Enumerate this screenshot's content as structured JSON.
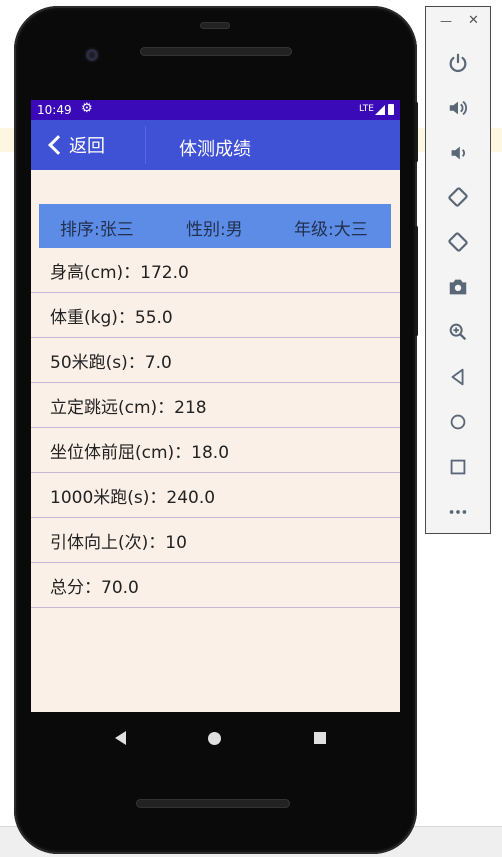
{
  "statusbar": {
    "time": "10:49",
    "network": "LTE"
  },
  "appbar": {
    "back_label": "返回",
    "title": "体测成绩"
  },
  "info": {
    "rank": "排序:张三",
    "gender": "性别:男",
    "grade": "年级:大三"
  },
  "rows": [
    "身高(cm)：172.0",
    "体重(kg)：55.0",
    "50米跑(s)：7.0",
    "立定跳远(cm)：218",
    "坐位体前屈(cm)：18.0",
    "1000米跑(s)：240.0",
    "引体向上(次)：10",
    "总分：70.0"
  ],
  "colors": {
    "statusbar": "#3a0ab8",
    "appbar": "#3f51d4",
    "infobar": "#5c8ce6",
    "screen_bg": "#fbf0e7"
  },
  "emulator_toolbar": {
    "window_controls": [
      "minimize-icon",
      "close-icon"
    ],
    "icons": [
      "power-icon",
      "volume-up-icon",
      "volume-down-icon",
      "rotate-left-icon",
      "rotate-right-icon",
      "camera-icon",
      "zoom-icon",
      "back-icon",
      "home-icon",
      "overview-icon",
      "more-icon"
    ]
  }
}
